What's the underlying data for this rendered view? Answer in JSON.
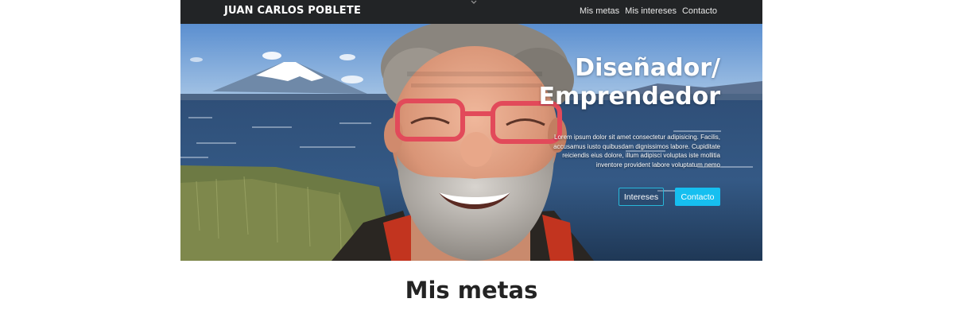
{
  "navbar": {
    "brand": "JUAN CARLOS POBLETE",
    "links": [
      {
        "label": "Mis metas"
      },
      {
        "label": "Mis intereses"
      },
      {
        "label": "Contacto"
      }
    ]
  },
  "hero": {
    "title_line1": "Diseñador/",
    "title_line2": "Emprendedor",
    "description": "Lorem ipsum dolor sit amet consectetur adipisicing. Facilis, accusamus iusto quibusdam dignissimos labore. Cupiditate reiciendis eius dolore, illum adipisci voluptas iste mollitia inventore provident labore voluptatum nemo",
    "buttons": {
      "secondary": "Intereses",
      "primary": "Contacto"
    }
  },
  "section": {
    "title": "Mis metas"
  },
  "colors": {
    "navbar_bg": "#222426",
    "accent": "#16bff0",
    "heading_text": "#232323"
  },
  "icons": {
    "toggle": "chevron-down-icon"
  }
}
